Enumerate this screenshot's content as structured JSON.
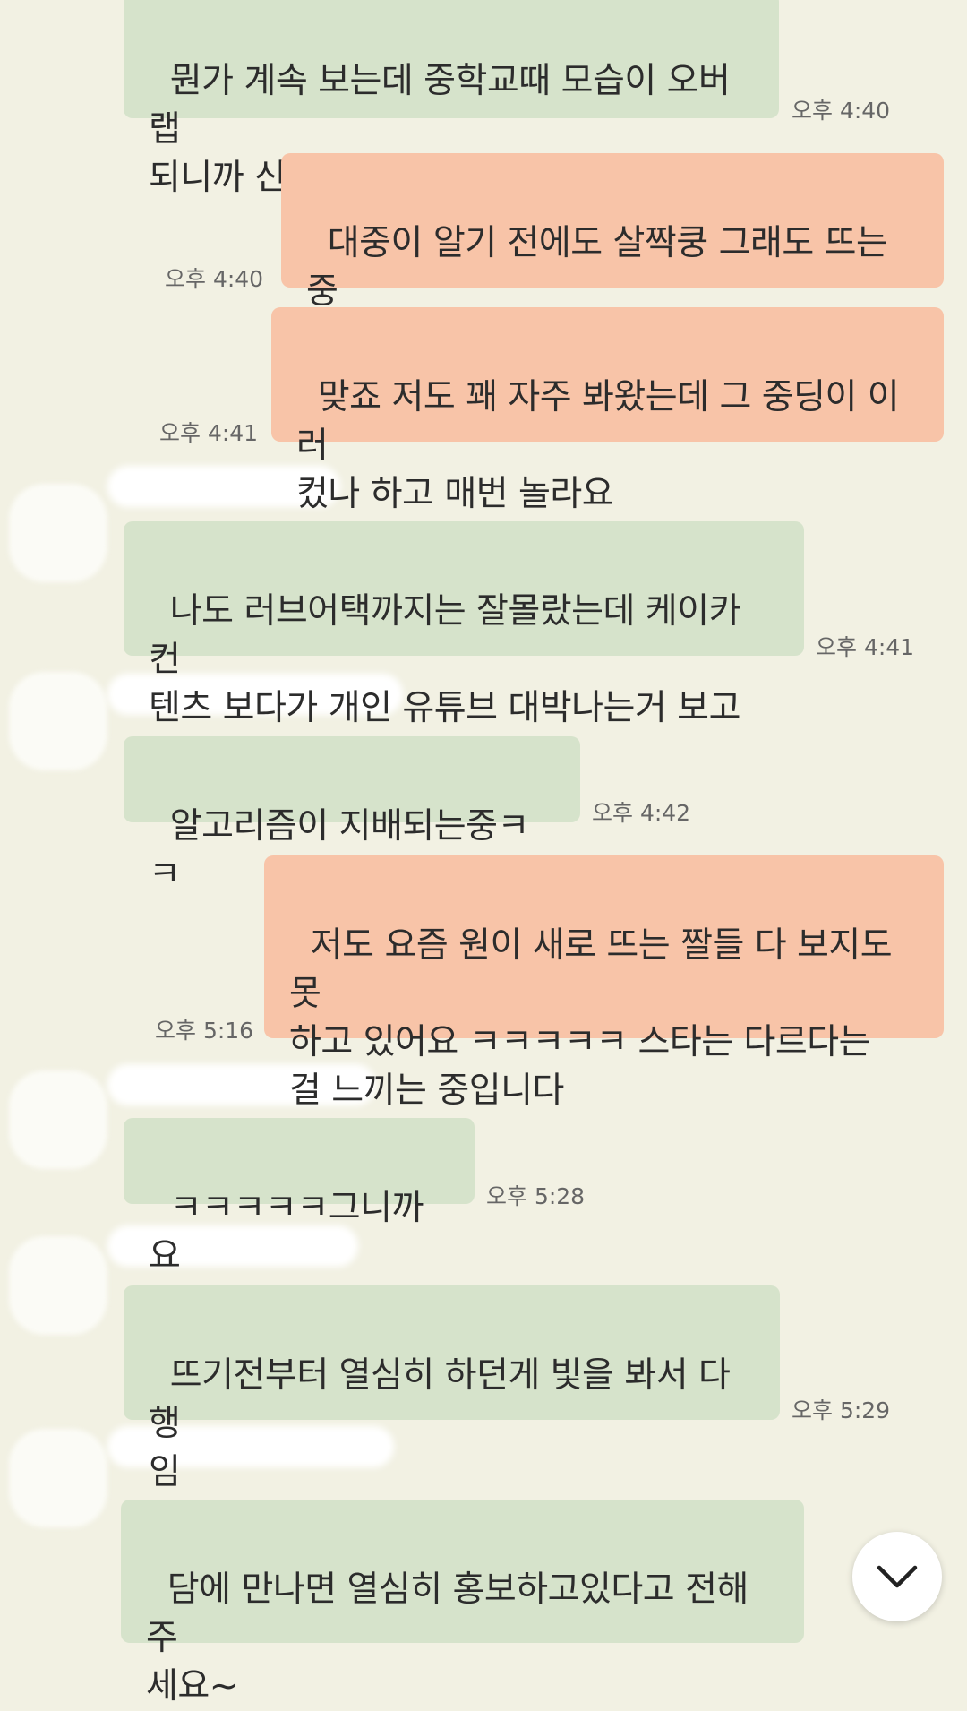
{
  "messages": [
    {
      "id": 1,
      "side": "in",
      "text": "뭔가 계속 보는데 중학교때 모습이 오버랩\n되니까 신기하네요ㅋㅋ",
      "time": "오후 4:40"
    },
    {
      "id": 2,
      "side": "out",
      "text": "대중이 알기 전에도 살짝쿵 그래도 뜨는 중\n이었달까",
      "time": "오후 4:40"
    },
    {
      "id": 3,
      "side": "out",
      "text": "맞죠 저도 꽤 자주 봐왔는데 그 중딩이 이러\n컸나 하고 매번 놀라요",
      "time": "오후 4:41"
    },
    {
      "id": 4,
      "side": "in",
      "text": "나도 러브어택까지는 잘몰랐는데 케이카 컨\n텐츠 보다가 개인 유튜브 대박나는거 보고",
      "time": "오후 4:41"
    },
    {
      "id": 5,
      "side": "in",
      "text": "알고리즘이 지배되는중ㅋㅋ",
      "time": "오후 4:42"
    },
    {
      "id": 6,
      "side": "out",
      "text": "저도 요즘 원이 새로 뜨는 짤들 다 보지도 못\n하고 있어요 ㅋㅋㅋㅋㅋ 스타는 다르다는\n걸 느끼는 중입니다",
      "time": "오후 5:16"
    },
    {
      "id": 7,
      "side": "in",
      "text": "ㅋㅋㅋㅋㅋ그니까요",
      "time": "오후 5:28"
    },
    {
      "id": 8,
      "side": "in",
      "text": "뜨기전부터 열심히 하던게 빛을 봐서 다행\n임",
      "time": "오후 5:29"
    },
    {
      "id": 9,
      "side": "in",
      "text": "담에 만나면 열심히 홍보하고있다고 전해주\n세요~",
      "time": ""
    }
  ],
  "scroll_button": {
    "icon": "chevron-down-icon"
  },
  "colors": {
    "background": "#f2f1e3",
    "incoming_bubble": "#d6e3cb",
    "outgoing_bubble": "#f8c4a8"
  }
}
